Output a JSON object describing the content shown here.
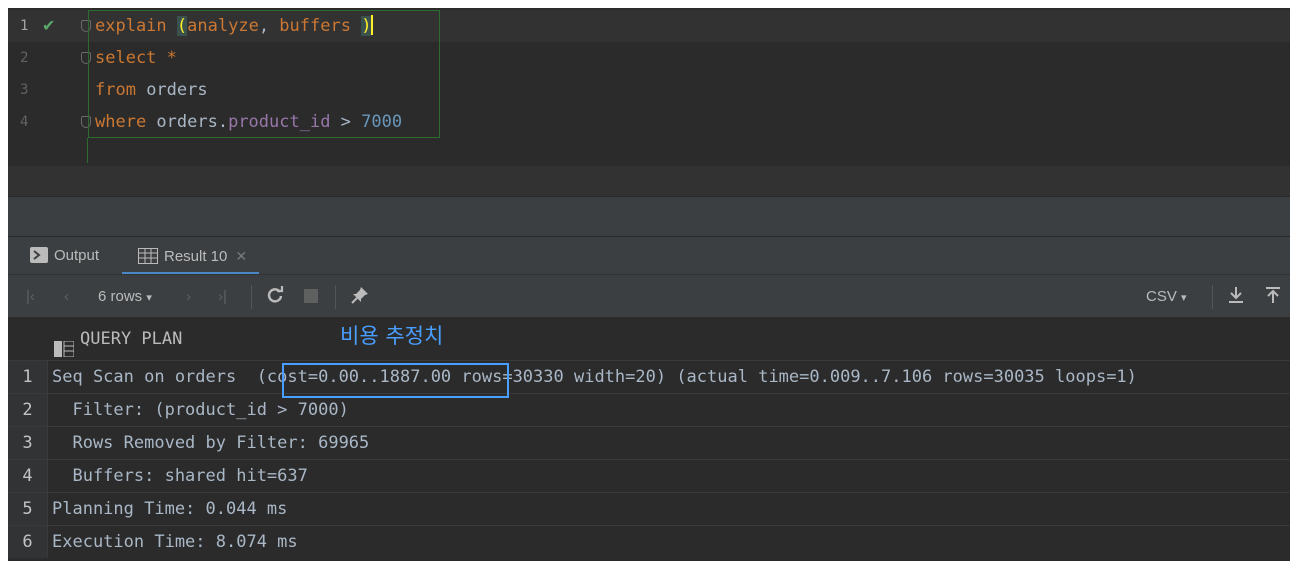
{
  "editor": {
    "lines": [
      {
        "num": "1",
        "tokens": [
          {
            "t": "explain",
            "c": "kw"
          },
          {
            "t": " ",
            "c": ""
          },
          {
            "t": "(",
            "c": "paren-hl"
          },
          {
            "t": "analyze",
            "c": "kw"
          },
          {
            "t": ", ",
            "c": ""
          },
          {
            "t": "buffers",
            "c": "kw"
          },
          {
            "t": " ",
            "c": ""
          },
          {
            "t": ")",
            "c": "paren-hl"
          }
        ]
      },
      {
        "num": "2",
        "tokens": [
          {
            "t": "select",
            "c": "kw"
          },
          {
            "t": " ",
            "c": ""
          },
          {
            "t": "*",
            "c": "kw"
          }
        ]
      },
      {
        "num": "3",
        "tokens": [
          {
            "t": "from",
            "c": "kw"
          },
          {
            "t": " orders",
            "c": ""
          }
        ]
      },
      {
        "num": "4",
        "tokens": [
          {
            "t": "where",
            "c": "kw"
          },
          {
            "t": " orders.",
            "c": ""
          },
          {
            "t": "product_id",
            "c": "field"
          },
          {
            "t": " > ",
            "c": ""
          },
          {
            "t": "7000",
            "c": "num"
          }
        ]
      }
    ]
  },
  "tabs": {
    "output_label": "Output",
    "result_label": "Result 10",
    "close_glyph": "✕"
  },
  "toolbar": {
    "rows_label": "6 rows",
    "export_label": "CSV"
  },
  "grid": {
    "column": "QUERY PLAN",
    "annotation": "비용 추정치",
    "rows": [
      {
        "n": "1",
        "text": "Seq Scan on orders  (cost=0.00..1887.00 rows=30330 width=20) (actual time=0.009..7.106 rows=30035 loops=1)"
      },
      {
        "n": "2",
        "text": "  Filter: (product_id > 7000)"
      },
      {
        "n": "3",
        "text": "  Rows Removed by Filter: 69965"
      },
      {
        "n": "4",
        "text": "  Buffers: shared hit=637"
      },
      {
        "n": "5",
        "text": "Planning Time: 0.044 ms"
      },
      {
        "n": "6",
        "text": "Execution Time: 8.074 ms"
      }
    ]
  },
  "colors": {
    "keyword": "#cc7832",
    "field": "#9876aa",
    "number": "#6897bb",
    "annotation": "#4a9eff",
    "success": "#59a869"
  }
}
